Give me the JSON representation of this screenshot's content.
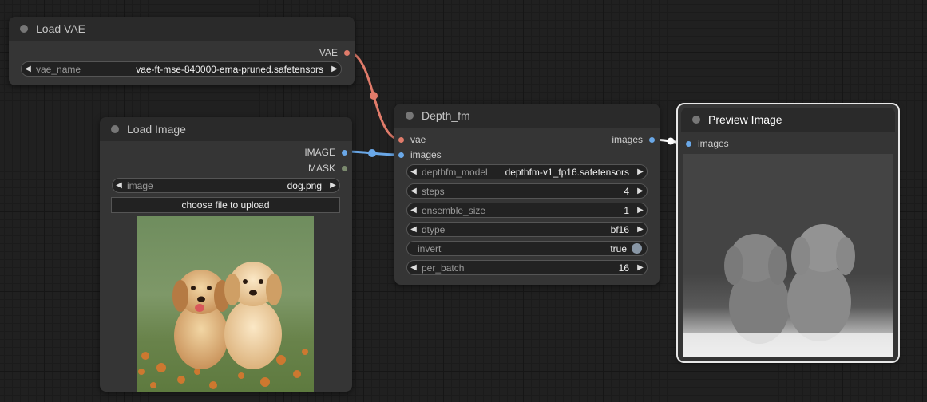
{
  "nodes": {
    "load_vae": {
      "title": "Load VAE",
      "output_label": "VAE",
      "widget_label": "vae_name",
      "widget_value": "vae-ft-mse-840000-ema-pruned.safetensors"
    },
    "load_image": {
      "title": "Load Image",
      "outputs": [
        "IMAGE",
        "MASK"
      ],
      "widget_label": "image",
      "widget_value": "dog.png",
      "upload_label": "choose file to upload"
    },
    "depth_fm": {
      "title": "Depth_fm",
      "inputs": [
        "vae",
        "images"
      ],
      "output_label": "images",
      "widgets": [
        {
          "label": "depthfm_model",
          "value": "depthfm-v1_fp16.safetensors"
        },
        {
          "label": "steps",
          "value": "4"
        },
        {
          "label": "ensemble_size",
          "value": "1"
        },
        {
          "label": "dtype",
          "value": "bf16"
        },
        {
          "label": "invert",
          "value": "true"
        },
        {
          "label": "per_batch",
          "value": "16"
        }
      ]
    },
    "preview_image": {
      "title": "Preview Image",
      "input_label": "images"
    }
  },
  "colors": {
    "vae_link": "#e07b6a",
    "image_link": "#6aa8e8",
    "mask_slot": "#7b8a6e",
    "preview_link": "#ffffff"
  }
}
